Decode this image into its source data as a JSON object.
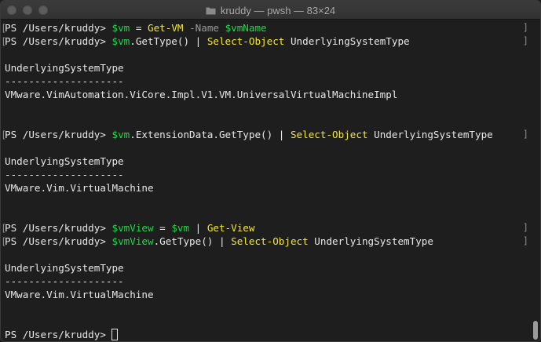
{
  "window": {
    "title": "kruddy — pwsh — 83×24"
  },
  "prompt": "PS /Users/kruddy> ",
  "lines": [
    {
      "segs": [
        {
          "t": "PS /Users/kruddy> ",
          "c": "plain"
        },
        {
          "t": "$vm",
          "c": "var"
        },
        {
          "t": " = ",
          "c": "plain"
        },
        {
          "t": "Get-VM",
          "c": "cmd"
        },
        {
          "t": " -Name ",
          "c": "param"
        },
        {
          "t": "$vmName",
          "c": "var"
        }
      ],
      "mark": "]"
    },
    {
      "segs": [
        {
          "t": "PS /Users/kruddy> ",
          "c": "plain"
        },
        {
          "t": "$vm",
          "c": "var"
        },
        {
          "t": ".GetType() | ",
          "c": "plain"
        },
        {
          "t": "Select-Object",
          "c": "cmd"
        },
        {
          "t": " UnderlyingSystemType",
          "c": "plain"
        }
      ],
      "mark": "]"
    },
    {
      "segs": []
    },
    {
      "segs": [
        {
          "t": "UnderlyingSystemType",
          "c": "plain"
        }
      ]
    },
    {
      "segs": [
        {
          "t": "--------------------",
          "c": "plain"
        }
      ]
    },
    {
      "segs": [
        {
          "t": "VMware.VimAutomation.ViCore.Impl.V1.VM.UniversalVirtualMachineImpl",
          "c": "plain"
        }
      ]
    },
    {
      "segs": []
    },
    {
      "segs": []
    },
    {
      "segs": [
        {
          "t": "PS /Users/kruddy> ",
          "c": "plain"
        },
        {
          "t": "$vm",
          "c": "var"
        },
        {
          "t": ".ExtensionData.GetType() | ",
          "c": "plain"
        },
        {
          "t": "Select-Object",
          "c": "cmd"
        },
        {
          "t": " UnderlyingSystemType ",
          "c": "plain"
        }
      ],
      "mark": "]"
    },
    {
      "segs": []
    },
    {
      "segs": [
        {
          "t": "UnderlyingSystemType",
          "c": "plain"
        }
      ]
    },
    {
      "segs": [
        {
          "t": "--------------------",
          "c": "plain"
        }
      ]
    },
    {
      "segs": [
        {
          "t": "VMware.Vim.VirtualMachine",
          "c": "plain"
        }
      ]
    },
    {
      "segs": []
    },
    {
      "segs": []
    },
    {
      "segs": [
        {
          "t": "PS /Users/kruddy> ",
          "c": "plain"
        },
        {
          "t": "$vmView",
          "c": "var"
        },
        {
          "t": " = ",
          "c": "plain"
        },
        {
          "t": "$vm",
          "c": "var"
        },
        {
          "t": " | ",
          "c": "plain"
        },
        {
          "t": "Get-View",
          "c": "cmd"
        }
      ],
      "mark": "]"
    },
    {
      "segs": [
        {
          "t": "PS /Users/kruddy> ",
          "c": "plain"
        },
        {
          "t": "$vmView",
          "c": "var"
        },
        {
          "t": ".GetType() | ",
          "c": "plain"
        },
        {
          "t": "Select-Object",
          "c": "cmd"
        },
        {
          "t": " UnderlyingSystemType",
          "c": "plain"
        }
      ],
      "mark": "]"
    },
    {
      "segs": []
    },
    {
      "segs": [
        {
          "t": "UnderlyingSystemType",
          "c": "plain"
        }
      ]
    },
    {
      "segs": [
        {
          "t": "--------------------",
          "c": "plain"
        }
      ]
    },
    {
      "segs": [
        {
          "t": "VMware.Vim.VirtualMachine",
          "c": "plain"
        }
      ]
    },
    {
      "segs": []
    },
    {
      "segs": []
    },
    {
      "segs": [
        {
          "t": "PS /Users/kruddy> ",
          "c": "plain"
        }
      ],
      "cursor": true
    }
  ],
  "colors": {
    "variable": "#27d34a",
    "cmdlet": "#f2e638",
    "parameter": "#9a9a9a",
    "text": "#e8e8e8",
    "background": "#1e1e1e"
  }
}
